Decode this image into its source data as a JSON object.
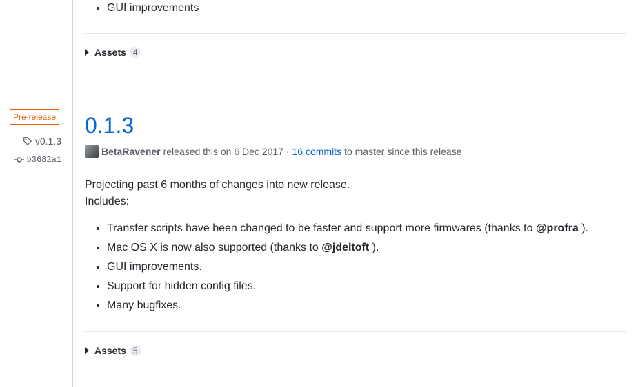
{
  "previous_release": {
    "notes": [
      "GUI improvements"
    ],
    "assets_label": "Assets",
    "assets_count": "4"
  },
  "release": {
    "badge": "Pre-release",
    "tag": "v0.1.3",
    "commit_sha": "b3682a1",
    "title": "0.1.3",
    "author": "BetaRavener",
    "released_text": "released this on 6 Dec 2017 ·",
    "commits_link": "16 commits",
    "commits_suffix": "to master since this release",
    "intro_line1": "Projecting past 6 months of changes into new release.",
    "intro_line2": "Includes:",
    "notes": [
      {
        "before": "Transfer scripts have been changed to be faster and support more firmwares (thanks to ",
        "mention": "@profra",
        "after": " )."
      },
      {
        "before": "Mac OS X is now also supported (thanks to ",
        "mention": "@jdeltoft",
        "after": " )."
      },
      {
        "before": "GUI improvements.",
        "mention": "",
        "after": ""
      },
      {
        "before": "Support for hidden config files.",
        "mention": "",
        "after": ""
      },
      {
        "before": "Many bugfixes.",
        "mention": "",
        "after": ""
      }
    ],
    "assets_label": "Assets",
    "assets_count": "5"
  },
  "colors": {
    "link": "#0366d6",
    "prerelease": "#e36209",
    "muted": "#586069"
  }
}
